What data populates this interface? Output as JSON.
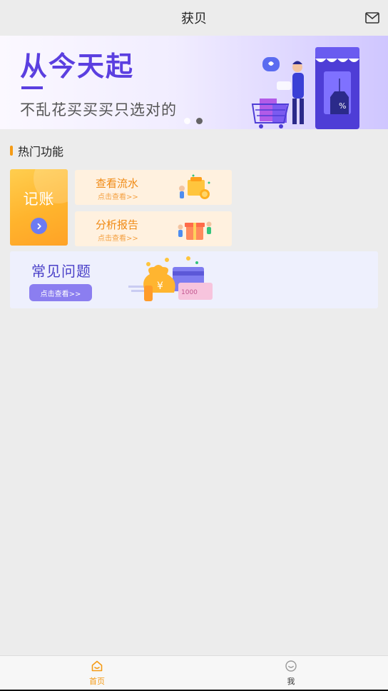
{
  "header": {
    "title": "获贝",
    "mail_icon": "mail-icon"
  },
  "banner": {
    "headline": "从今天起",
    "subtitle": "不乱花买买买只选对的",
    "slide_count": 2,
    "active_slide": 2
  },
  "hot_functions": {
    "title": "热门功能",
    "jizhang": {
      "label": "记账",
      "icon": "chevron-right-icon"
    },
    "cards": [
      {
        "title": "查看流水",
        "subtitle": "点击查看>>"
      },
      {
        "title": "分析报告",
        "subtitle": "点击查看>>"
      }
    ],
    "faq": {
      "title": "常见问题",
      "button": "点击查看>>"
    }
  },
  "bottom_nav": {
    "items": [
      {
        "label": "首页",
        "icon": "home-icon",
        "active": true
      },
      {
        "label": "我",
        "icon": "smile-icon",
        "active": false
      }
    ]
  },
  "colors": {
    "accent": "#f59b15",
    "brand_purple": "#5b3fe0",
    "card_orange": "#f08a14",
    "faq_purple": "#4a40c8"
  }
}
